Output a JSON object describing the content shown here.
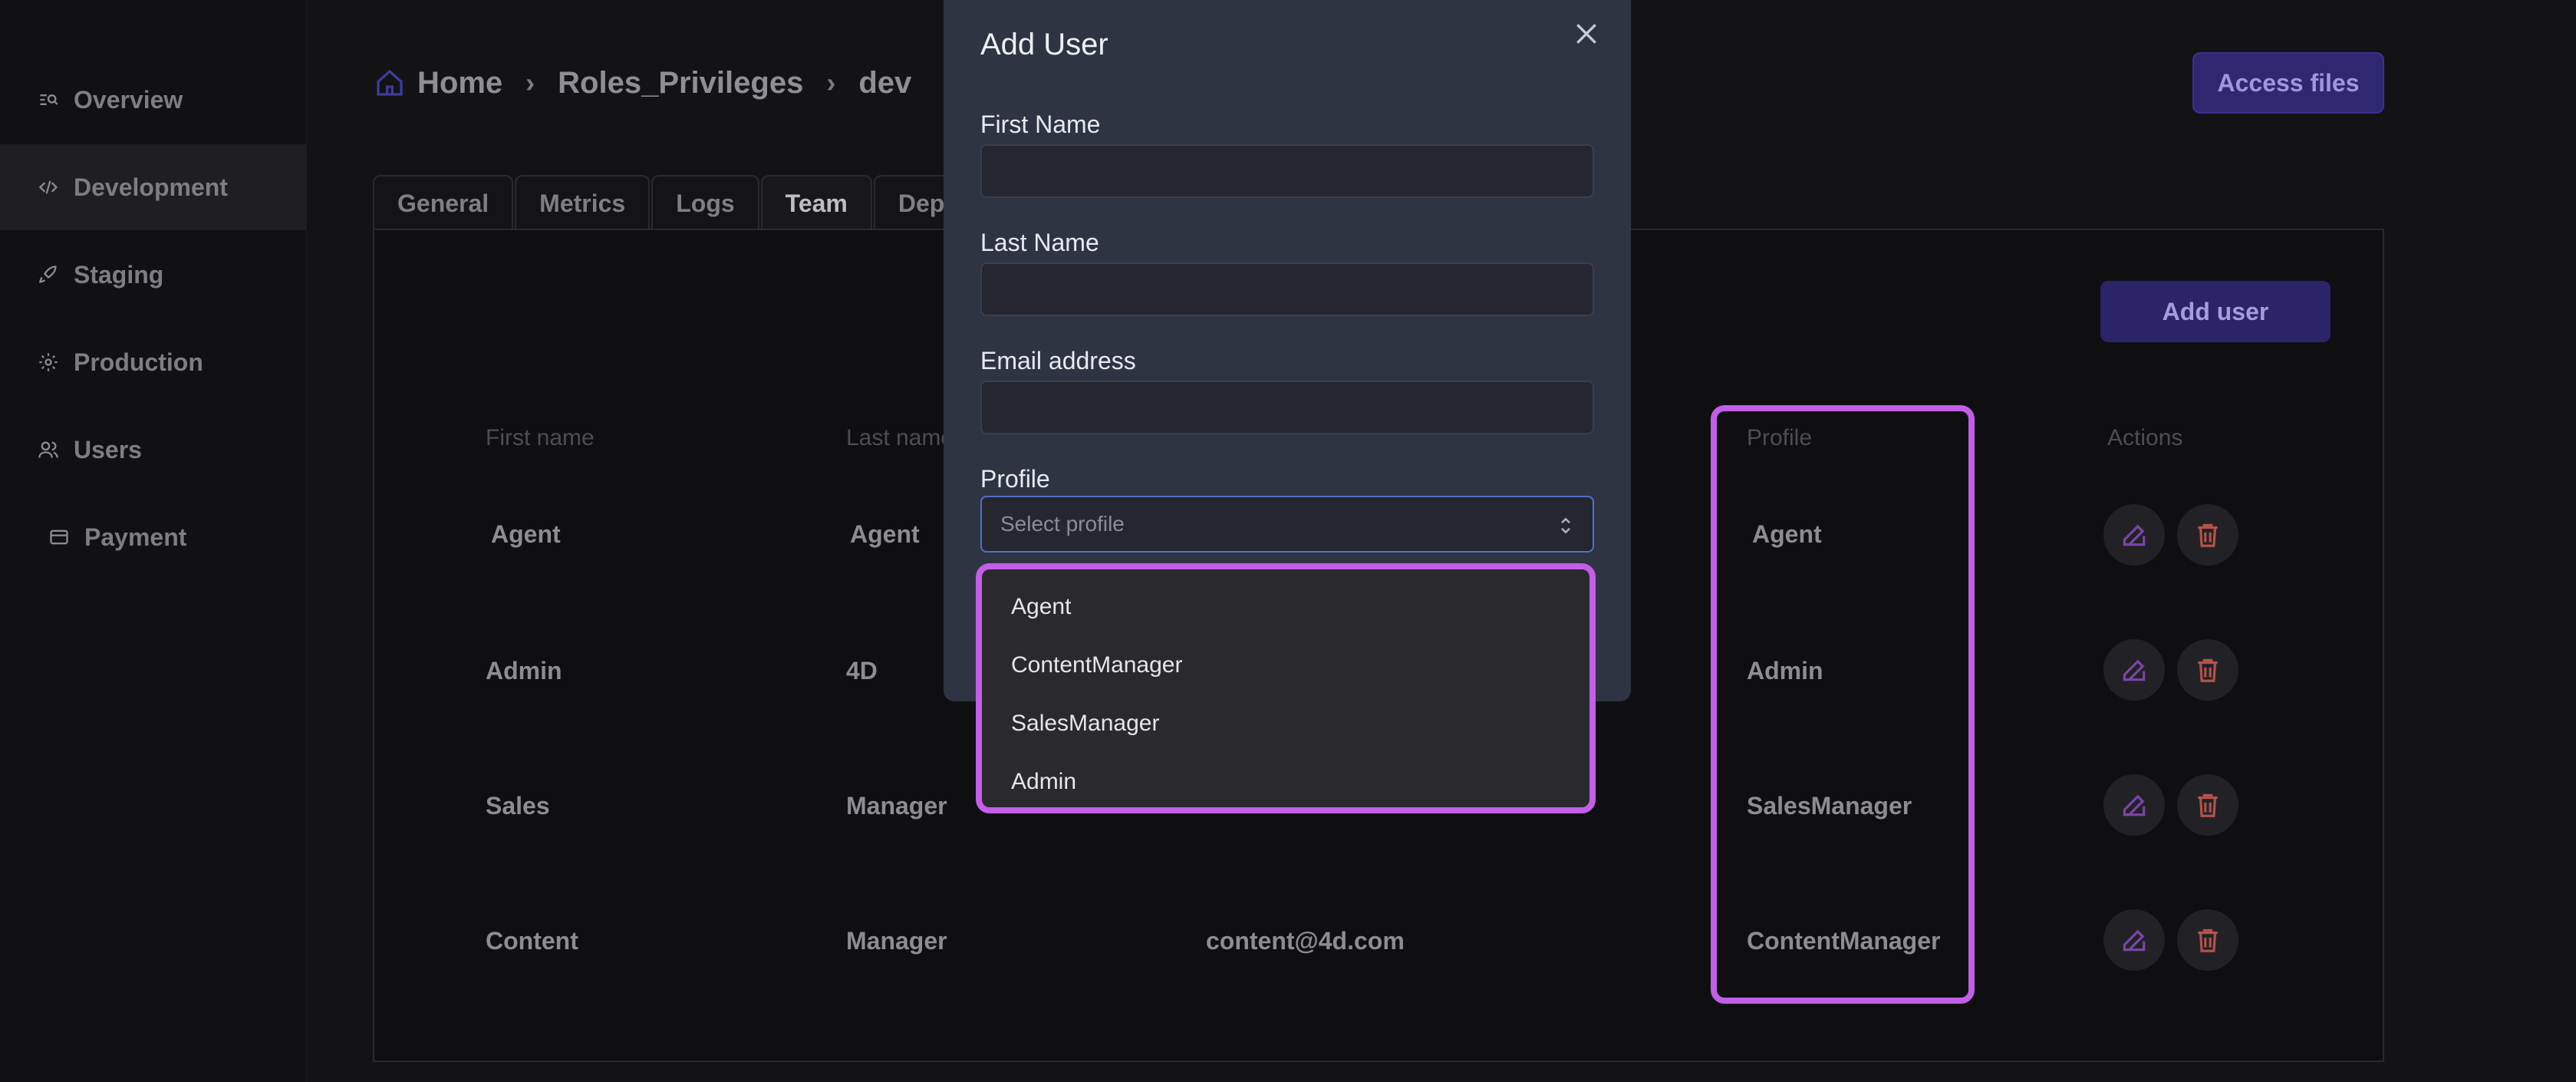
{
  "sidebar": {
    "items": [
      {
        "label": "Overview",
        "icon": "overview-icon"
      },
      {
        "label": "Development",
        "icon": "code-icon"
      },
      {
        "label": "Staging",
        "icon": "rocket-icon"
      },
      {
        "label": "Production",
        "icon": "gear-icon"
      },
      {
        "label": "Users",
        "icon": "users-icon"
      },
      {
        "label": "Payment",
        "icon": "card-icon"
      }
    ]
  },
  "breadcrumb": [
    "Home",
    "Roles_Privileges",
    "dev"
  ],
  "header": {
    "access_files": "Access files"
  },
  "tabs": [
    "General",
    "Metrics",
    "Logs",
    "Team",
    "Dep"
  ],
  "team": {
    "add_user": "Add user",
    "columns": [
      "First name",
      "Last name",
      "Profile",
      "Actions"
    ],
    "rows": [
      {
        "first": "Agent",
        "last": "Agent",
        "email": "",
        "profile": "Agent"
      },
      {
        "first": "Admin",
        "last": "4D",
        "email": "",
        "profile": "Admin"
      },
      {
        "first": "Sales",
        "last": "Manager",
        "email": "",
        "profile": "SalesManager"
      },
      {
        "first": "Content",
        "last": "Manager",
        "email": "content@4d.com",
        "profile": "ContentManager"
      }
    ]
  },
  "modal": {
    "title": "Add User",
    "first_name_label": "First Name",
    "last_name_label": "Last Name",
    "email_label": "Email address",
    "profile_label": "Profile",
    "profile_placeholder": "Select profile",
    "profile_options": [
      "Agent",
      "ContentManager",
      "SalesManager",
      "Admin"
    ]
  },
  "colors": {
    "accent": "#c25ee8",
    "primary": "#2f2770"
  }
}
